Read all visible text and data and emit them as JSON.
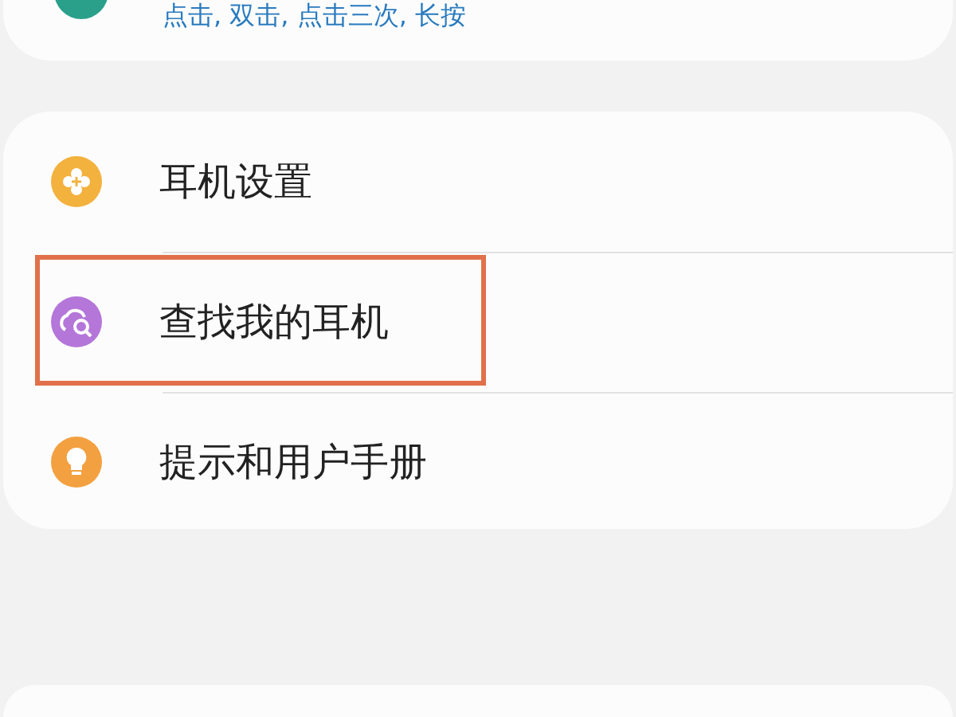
{
  "top_card": {
    "subtitle": "点击, 双击, 点击三次, 长按"
  },
  "menu": [
    {
      "kind": "gear",
      "label": "耳机设置",
      "highlighted": false
    },
    {
      "kind": "find",
      "label": "查找我的耳机",
      "highlighted": true
    },
    {
      "kind": "tips",
      "label": "提示和用户手册",
      "highlighted": false
    }
  ]
}
